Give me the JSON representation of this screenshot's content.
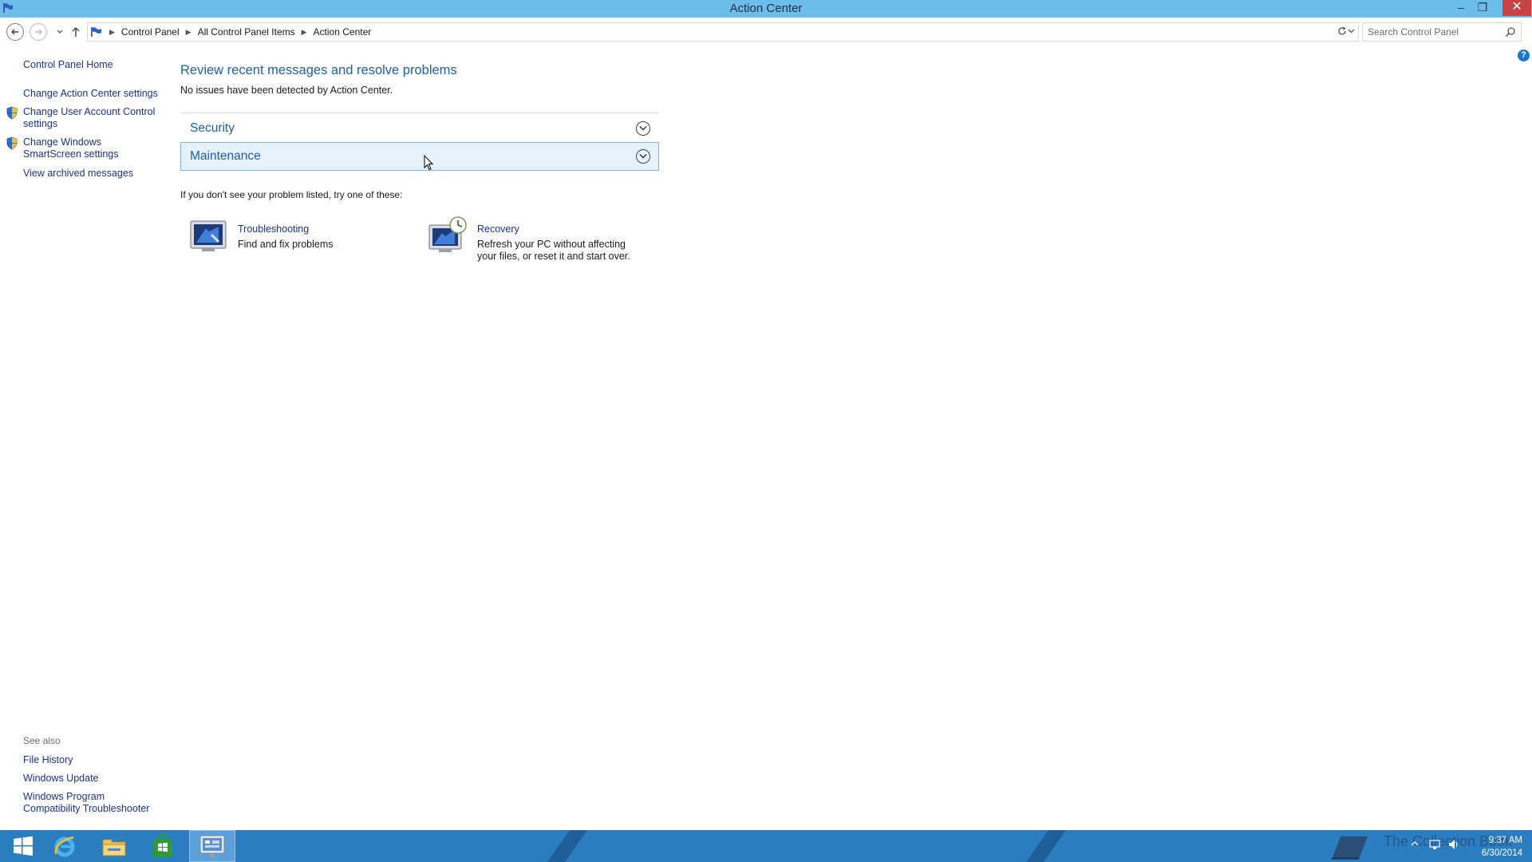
{
  "window": {
    "title": "Action Center",
    "controls": {
      "minimize": "–",
      "restore": "❐",
      "close": "✕"
    }
  },
  "nav": {
    "breadcrumbs": [
      "Control Panel",
      "All Control Panel Items",
      "Action Center"
    ],
    "search_placeholder": "Search Control Panel"
  },
  "sidebar": {
    "home": "Control Panel Home",
    "links": [
      {
        "label": "Change Action Center settings",
        "icon": ""
      },
      {
        "label": "Change User Account Control settings",
        "icon": "shield-icon"
      },
      {
        "label": "Change Windows SmartScreen settings",
        "icon": "shield-icon"
      },
      {
        "label": "View archived messages",
        "icon": ""
      }
    ],
    "see_also_title": "See also",
    "see_also": [
      "File History",
      "Windows Update",
      "Windows Program Compatibility Troubleshooter"
    ]
  },
  "main": {
    "title": "Review recent messages and resolve problems",
    "subtitle": "No issues have been detected by Action Center.",
    "sections": [
      {
        "label": "Security",
        "expanded": false,
        "highlighted": false
      },
      {
        "label": "Maintenance",
        "expanded": false,
        "highlighted": true
      }
    ],
    "hint": "If you don't see your problem listed, try one of these:",
    "tiles": [
      {
        "name": "Troubleshooting",
        "desc": "Find and fix problems",
        "icon": "troubleshooting-icon"
      },
      {
        "name": "Recovery",
        "desc": "Refresh your PC without affecting your files, or reset it and start over.",
        "icon": "recovery-icon"
      }
    ]
  },
  "taskbar": {
    "items": [
      "start-icon",
      "internet-explorer-icon",
      "file-explorer-icon",
      "store-icon",
      "control-panel-icon"
    ],
    "active": "control-panel-icon",
    "watermark": "The Collection Book",
    "clock": {
      "time": "9:37 AM",
      "date": "6/30/2014"
    }
  },
  "colors": {
    "titlebar": "#6cbdec",
    "link": "#1e3287",
    "heading": "#1e5fa8",
    "taskbar": "#2c7cc0",
    "section_highlight": "#e5f1fb"
  }
}
